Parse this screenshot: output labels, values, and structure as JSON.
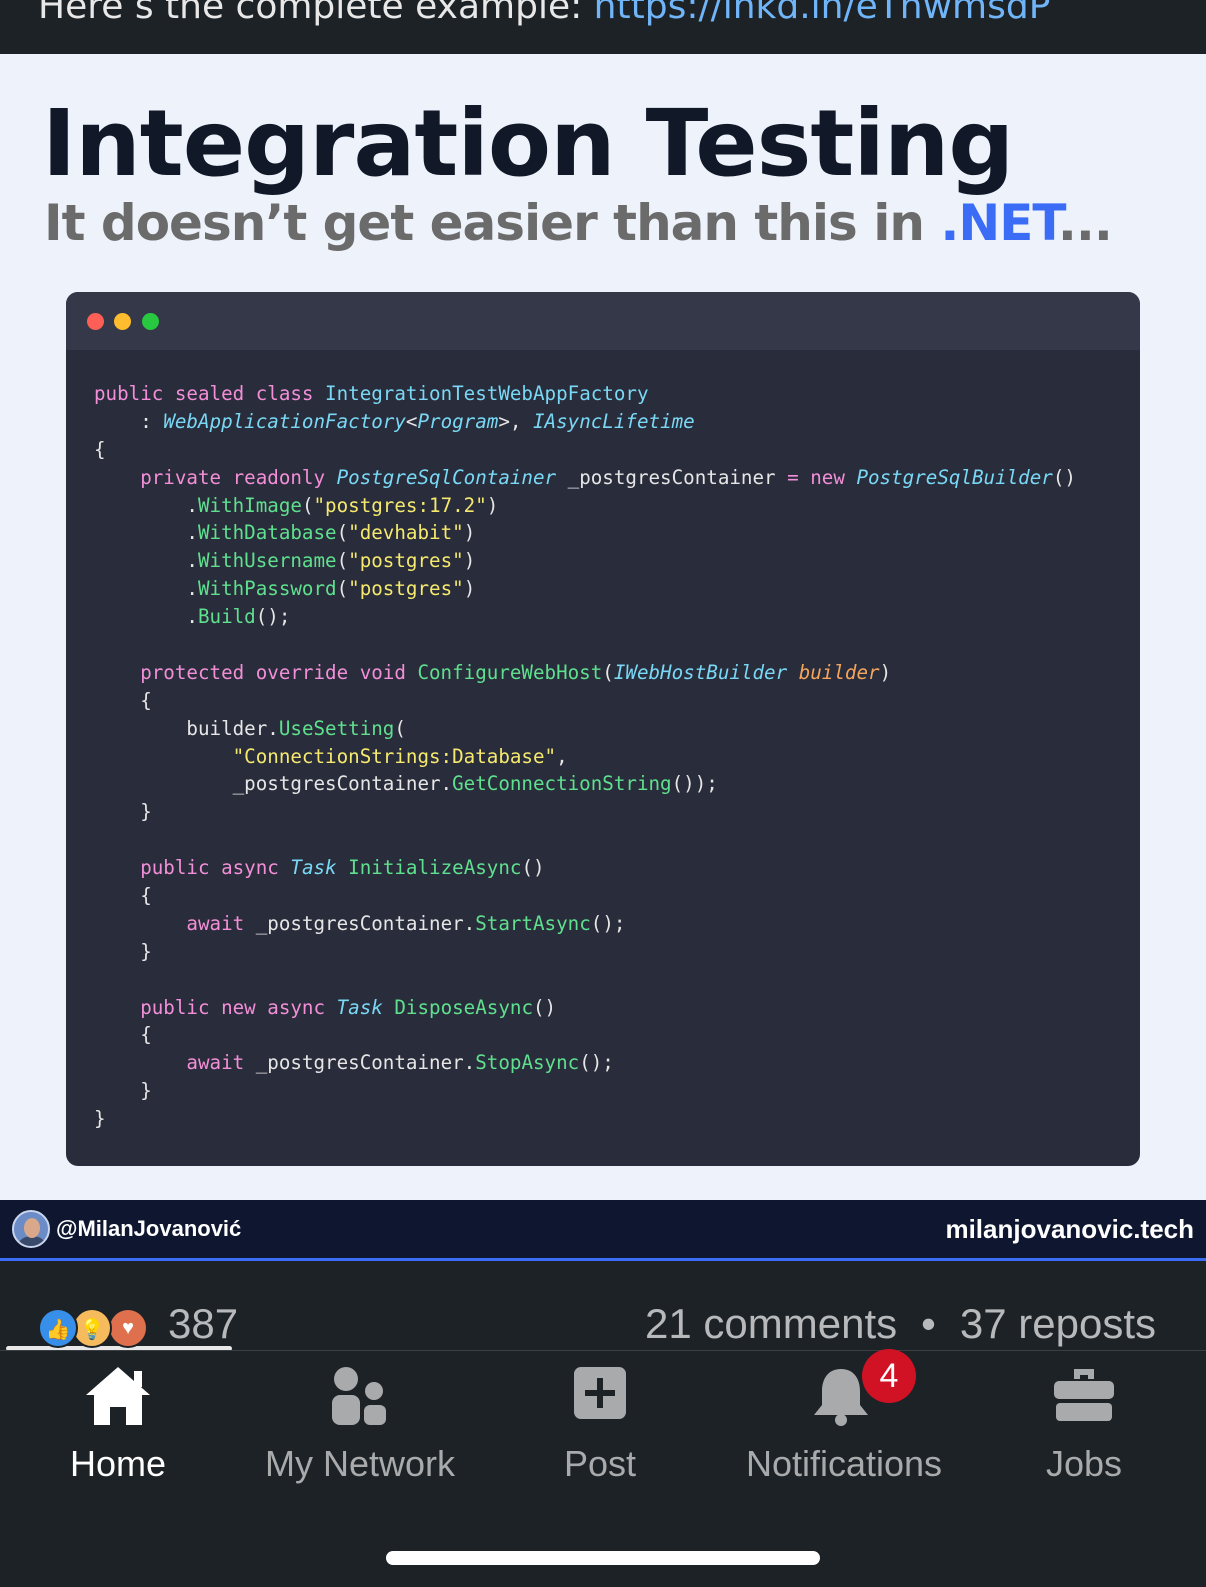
{
  "top_banner": {
    "prefix": "Here’s the complete example: ",
    "link": "https://lnkd.in/eThwmsdP"
  },
  "post_image": {
    "title": "Integration Testing",
    "subtitle_prefix": "It doesn’t get easier than this in ",
    "subtitle_highlight": ".NET",
    "subtitle_suffix": "...",
    "code_lines": [
      [
        [
          "kw",
          "public sealed class "
        ],
        [
          "ty",
          "IntegrationTestWebAppFactory"
        ]
      ],
      [
        [
          "pl",
          "    : "
        ],
        [
          "tyi",
          "WebApplicationFactory"
        ],
        [
          "pl",
          "<"
        ],
        [
          "tyi",
          "Program"
        ],
        [
          "pl",
          ">, "
        ],
        [
          "tyi",
          "IAsyncLifetime"
        ]
      ],
      [
        [
          "pl",
          "{"
        ]
      ],
      [
        [
          "kw",
          "    private readonly "
        ],
        [
          "tyi",
          "PostgreSqlContainer"
        ],
        [
          "pl",
          " _postgresContainer "
        ],
        [
          "kw",
          "= new "
        ],
        [
          "tyi",
          "PostgreSqlBuilder"
        ],
        [
          "pl",
          "()"
        ]
      ],
      [
        [
          "pl",
          "        ."
        ],
        [
          "fn",
          "WithImage"
        ],
        [
          "pl",
          "("
        ],
        [
          "st",
          "\"postgres:17.2\""
        ],
        [
          "pl",
          ")"
        ]
      ],
      [
        [
          "pl",
          "        ."
        ],
        [
          "fn",
          "WithDatabase"
        ],
        [
          "pl",
          "("
        ],
        [
          "st",
          "\"devhabit\""
        ],
        [
          "pl",
          ")"
        ]
      ],
      [
        [
          "pl",
          "        ."
        ],
        [
          "fn",
          "WithUsername"
        ],
        [
          "pl",
          "("
        ],
        [
          "st",
          "\"postgres\""
        ],
        [
          "pl",
          ")"
        ]
      ],
      [
        [
          "pl",
          "        ."
        ],
        [
          "fn",
          "WithPassword"
        ],
        [
          "pl",
          "("
        ],
        [
          "st",
          "\"postgres\""
        ],
        [
          "pl",
          ")"
        ]
      ],
      [
        [
          "pl",
          "        ."
        ],
        [
          "fn",
          "Build"
        ],
        [
          "pl",
          "();"
        ]
      ],
      [
        [
          "pl",
          ""
        ]
      ],
      [
        [
          "kw",
          "    protected override void "
        ],
        [
          "fn",
          "ConfigureWebHost"
        ],
        [
          "pl",
          "("
        ],
        [
          "tyi",
          "IWebHostBuilder"
        ],
        [
          "pl",
          " "
        ],
        [
          "pa",
          "builder"
        ],
        [
          "pl",
          ")"
        ]
      ],
      [
        [
          "pl",
          "    {"
        ]
      ],
      [
        [
          "pl",
          "        builder."
        ],
        [
          "fn",
          "UseSetting"
        ],
        [
          "pl",
          "("
        ]
      ],
      [
        [
          "st",
          "            \"ConnectionStrings:Database\""
        ],
        [
          "pl",
          ","
        ]
      ],
      [
        [
          "pl",
          "            _postgresContainer."
        ],
        [
          "fn",
          "GetConnectionString"
        ],
        [
          "pl",
          "());"
        ]
      ],
      [
        [
          "pl",
          "    }"
        ]
      ],
      [
        [
          "pl",
          ""
        ]
      ],
      [
        [
          "kw",
          "    public async "
        ],
        [
          "tyi",
          "Task"
        ],
        [
          "pl",
          " "
        ],
        [
          "fn",
          "InitializeAsync"
        ],
        [
          "pl",
          "()"
        ]
      ],
      [
        [
          "pl",
          "    {"
        ]
      ],
      [
        [
          "kw",
          "        await "
        ],
        [
          "pl",
          "_postgresContainer."
        ],
        [
          "fn",
          "StartAsync"
        ],
        [
          "pl",
          "();"
        ]
      ],
      [
        [
          "pl",
          "    }"
        ]
      ],
      [
        [
          "pl",
          ""
        ]
      ],
      [
        [
          "kw",
          "    public new async "
        ],
        [
          "tyi",
          "Task"
        ],
        [
          "pl",
          " "
        ],
        [
          "fn",
          "DisposeAsync"
        ],
        [
          "pl",
          "()"
        ]
      ],
      [
        [
          "pl",
          "    {"
        ]
      ],
      [
        [
          "kw",
          "        await "
        ],
        [
          "pl",
          "_postgresContainer."
        ],
        [
          "fn",
          "StopAsync"
        ],
        [
          "pl",
          "();"
        ]
      ],
      [
        [
          "pl",
          "    }"
        ]
      ],
      [
        [
          "pl",
          "}"
        ]
      ]
    ],
    "footer_handle": "@MilanJovanović",
    "footer_site": "milanjovanovic.tech"
  },
  "social": {
    "reaction_icons": [
      "like-icon",
      "insightful-icon",
      "love-icon"
    ],
    "reaction_count": "387",
    "comments": "21 comments",
    "separator": "•",
    "reposts": "37 reposts"
  },
  "nav": {
    "home": "Home",
    "network": "My Network",
    "post": "Post",
    "notifications": "Notifications",
    "notifications_badge": "4",
    "jobs": "Jobs"
  },
  "colors": {
    "app_background": "#1d2226",
    "accent_blue": "#3b6cf6",
    "badge_red": "#d11124"
  }
}
